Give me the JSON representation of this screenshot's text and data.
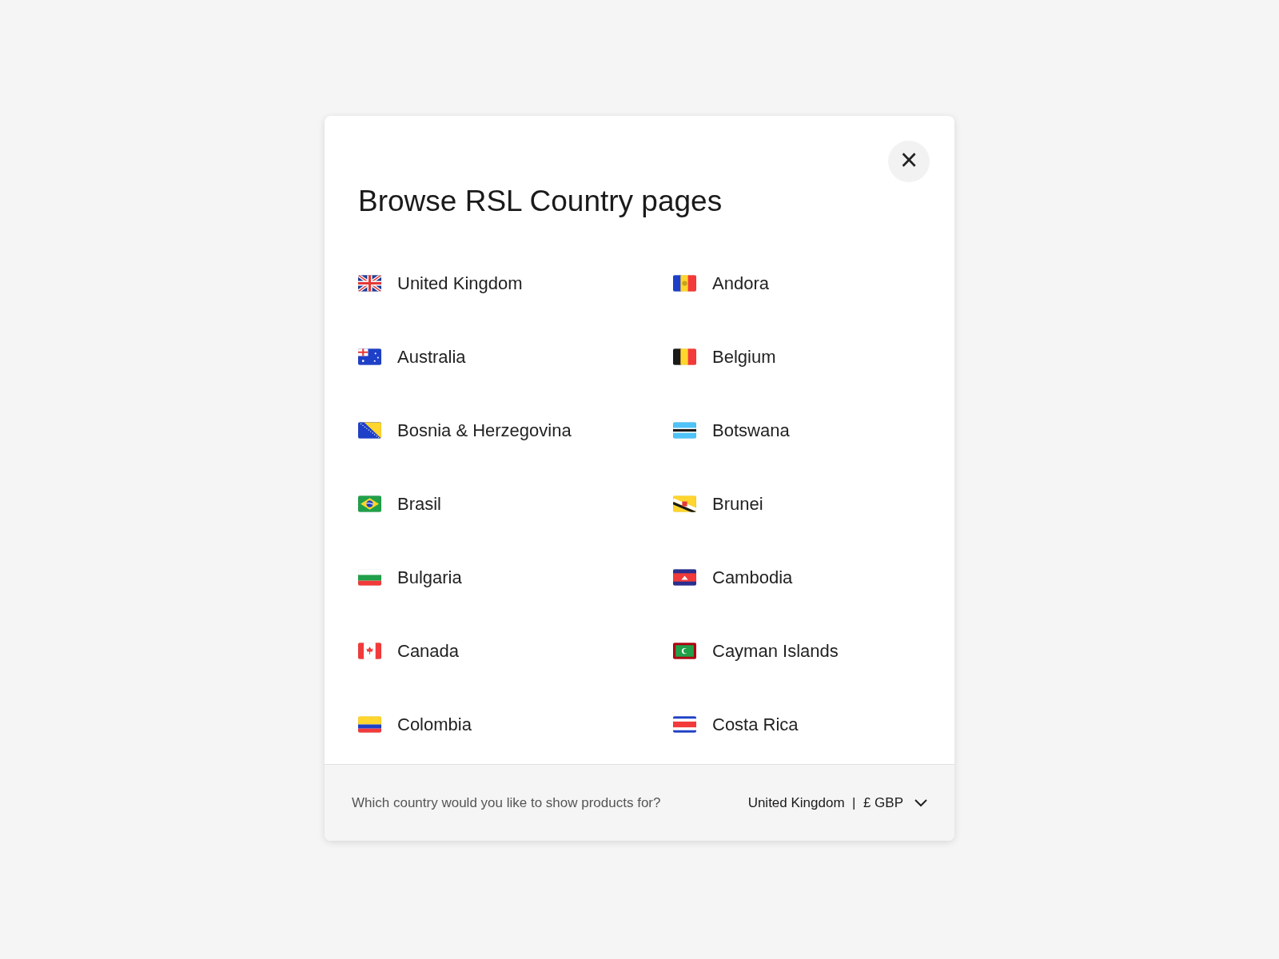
{
  "dialog": {
    "title": "Browse RSL Country pages",
    "close": "×",
    "countries": [
      {
        "name": "United Kingdom",
        "kind": "gb"
      },
      {
        "name": "Andora",
        "kind": "ad"
      },
      {
        "name": "Australia",
        "kind": "au"
      },
      {
        "name": "Belgium",
        "kind": "be"
      },
      {
        "name": "Bosnia & Herzegovina",
        "kind": "ba"
      },
      {
        "name": "Botswana",
        "kind": "bw"
      },
      {
        "name": "Brasil",
        "kind": "br"
      },
      {
        "name": "Brunei",
        "kind": "bn"
      },
      {
        "name": "Bulgaria",
        "kind": "bg"
      },
      {
        "name": "Cambodia",
        "kind": "kh"
      },
      {
        "name": "Canada",
        "kind": "ca"
      },
      {
        "name": "Cayman Islands",
        "kind": "ky"
      },
      {
        "name": "Colombia",
        "kind": "co"
      },
      {
        "name": "Costa Rica",
        "kind": "cr"
      }
    ],
    "footer": {
      "question": "Which country would you like to show products for?",
      "selection": "United Kingdom  |  £ GBP"
    }
  }
}
